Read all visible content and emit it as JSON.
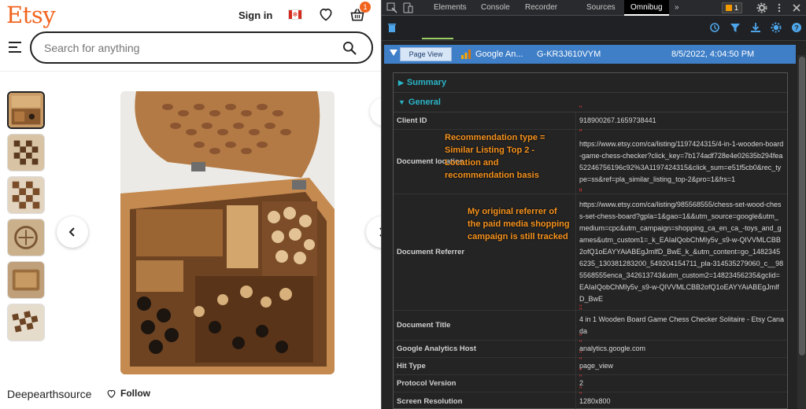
{
  "etsy": {
    "logo": "Etsy",
    "sign_in": "Sign in",
    "flag_leaf": "✻",
    "cart_count": "1",
    "search_placeholder": "Search for anything",
    "shop_name": "Deepearthsource",
    "follow_label": "Follow",
    "brand_color": "#f1641e"
  },
  "devtools": {
    "tabs": [
      "Elements",
      "Console",
      "Recorder",
      "Sources",
      "Omnibug"
    ],
    "active_tab": "Omnibug",
    "more_tabs": "»",
    "warning_count": "1",
    "request": {
      "type_button": "Page View",
      "provider": "Google An...",
      "account": "G-KR3J610VYM",
      "timestamp": "8/5/2022, 4:04:50 PM"
    },
    "sections": {
      "summary": "Summary",
      "general": "General"
    },
    "rows": [
      {
        "key": "Client ID",
        "value": "918900267.1659738441"
      },
      {
        "key": "Document location",
        "value": "https://www.etsy.com/ca/listing/1197424315/4-in-1-wooden-board-game-chess-checker?click_key=7b174adf728e4e02635b294fea52246756196c92%3A1197424315&click_sum=e51f5cb0&rec_type=ss&ref=pla_similar_listing_top-2&pro=1&frs=1"
      },
      {
        "key": "Document Referrer",
        "value": "https://www.etsy.com/ca/listing/985568555/chess-set-wood-chess-set-chess-board?gpla=1&gao=1&&utm_source=google&utm_medium=cpc&utm_campaign=shopping_ca_en_ca_-toys_and_games&utm_custom1=_k_EAIaIQobChMIy5v_s9-w-QIVVMLCBB2ofQ1oEAYYAiABEgJmlfD_BwE_k_&utm_content=go_14823456235_130381283200_549204154711_pla-314535279060_c__985568555enca_342613743&utm_custom2=14823456235&gclid=EAIaIQobChMIy5v_s9-w-QIVVMLCBB2ofQ1oEAYYAiABEgJmlfD_BwE"
      },
      {
        "key": "Document Title",
        "value": "4 in 1 Wooden Board Game Chess Checker Solitaire - Etsy Canada"
      },
      {
        "key": "Google Analytics Host",
        "value": "analytics.google.com"
      },
      {
        "key": "Hit Type",
        "value": "page_view"
      },
      {
        "key": "Protocol Version",
        "value": "2"
      },
      {
        "key": "Screen Resolution",
        "value": "1280x800"
      }
    ],
    "annotations": {
      "recommendation": "Recommendation type = Similar Listing Top 2 - Location and recommendation basis",
      "referrer": "My original referrer of the paid media shopping campaign is still tracked"
    },
    "colors": {
      "accent_blue": "#3f7fc8",
      "section_teal": "#2ab5c8",
      "quote_red": "#f23d3d",
      "annotation_orange": "#f7931e"
    }
  }
}
